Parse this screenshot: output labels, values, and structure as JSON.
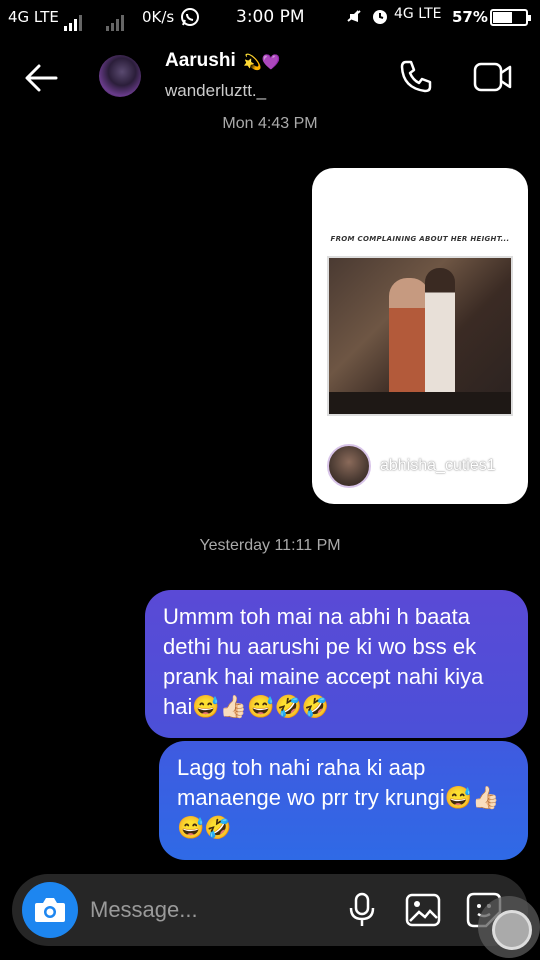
{
  "status_bar": {
    "network_left": "4G LTE",
    "speed": "0K/s",
    "time": "3:00 PM",
    "network_right": "4G LTE",
    "battery": "57%",
    "battery_level": 0.57
  },
  "header": {
    "name": "Aarushi",
    "name_emoji": "💫💜",
    "handle": "wanderluztt._"
  },
  "conversation": {
    "timestamp_1": "Mon 4:43 PM",
    "shared_post": {
      "caption": "FROM COMPLAINING ABOUT HER HEIGHT...",
      "username": "abhisha_cuties1"
    },
    "timestamp_2": "Yesterday 11:11 PM",
    "messages": [
      {
        "text": "Ummm toh mai na abhi h baata dethi hu aarushi pe ki wo bss ek prank hai maine accept nahi kiya hai😅👍🏻😅🤣🤣"
      },
      {
        "text": "Lagg toh nahi raha ki aap manaenge wo prr try krungi😅👍🏻😅🤣"
      }
    ]
  },
  "composer": {
    "placeholder": "Message..."
  },
  "colors": {
    "background": "#000000",
    "bubble_1": "#5a4ad6",
    "bubble_2": "#2f6ae6",
    "camera_button": "#1d86f0",
    "composer_bg": "#262626"
  }
}
